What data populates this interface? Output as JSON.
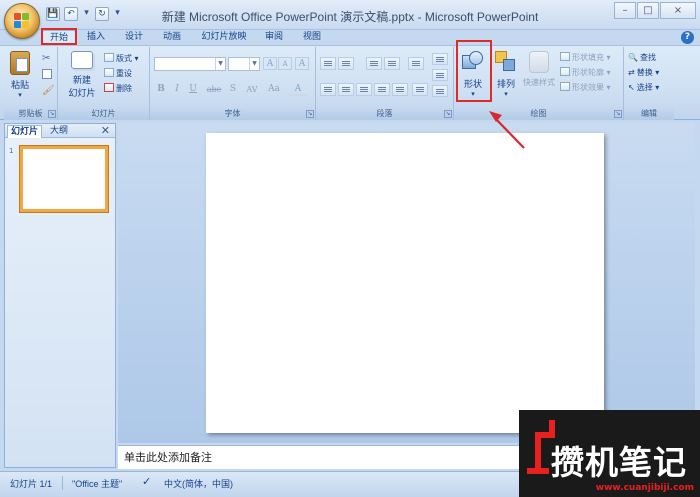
{
  "window": {
    "title": "新建 Microsoft Office PowerPoint 演示文稿.pptx - Microsoft PowerPoint",
    "minimize": "–",
    "maximize": "□",
    "close": "×"
  },
  "qat": {
    "save": "💾",
    "undo": "↶",
    "undo_dd": "▾",
    "redo": "↻",
    "more": "▾"
  },
  "tabs": [
    {
      "label": "开始"
    },
    {
      "label": "插入"
    },
    {
      "label": "设计"
    },
    {
      "label": "动画"
    },
    {
      "label": "幻灯片放映"
    },
    {
      "label": "审阅"
    },
    {
      "label": "视图"
    }
  ],
  "help": "?",
  "ribbon": {
    "clipboard": {
      "label": "剪贴板",
      "paste": "粘贴",
      "paste_dd": "▾"
    },
    "slides": {
      "label": "幻灯片",
      "new_slide_1": "新建",
      "new_slide_2": "幻灯片",
      "layout": "版式",
      "reset": "重设",
      "delete": "删除"
    },
    "font": {
      "label": "字体",
      "bold": "B",
      "italic": "I",
      "underline": "U",
      "strike": "abe",
      "shadow": "S",
      "spacing": "AV",
      "case": "Aa",
      "grow": "A",
      "shrink": "A",
      "clear": "A"
    },
    "paragraph": {
      "label": "段落"
    },
    "drawing": {
      "label": "绘图",
      "shapes": "形状",
      "shapes_dd": "▾",
      "arrange": "排列",
      "arrange_dd": "▾",
      "quick_styles": "快速样式",
      "shape_fill": "形状填充",
      "shape_outline": "形状轮廓",
      "shape_effects": "形状效果"
    },
    "editing": {
      "label": "编辑",
      "find": "查找",
      "replace": "替换",
      "select": "选择"
    }
  },
  "left_panel": {
    "tab_slides": "幻灯片",
    "tab_outline": "大纲",
    "close": "✕",
    "slide_number": "1"
  },
  "notes": {
    "placeholder": "单击此处添加备注"
  },
  "status": {
    "slide_info": "幻灯片 1/1",
    "theme": "\"Office 主题\"",
    "language": "中文(简体，中国)"
  },
  "watermark": {
    "text": "攒机笔记",
    "url": "www.cuanjibiji.com"
  },
  "colors": {
    "highlight_red": "#e02a2a",
    "slide_selected": "#f2a742",
    "ribbon_text": "#15428b"
  }
}
